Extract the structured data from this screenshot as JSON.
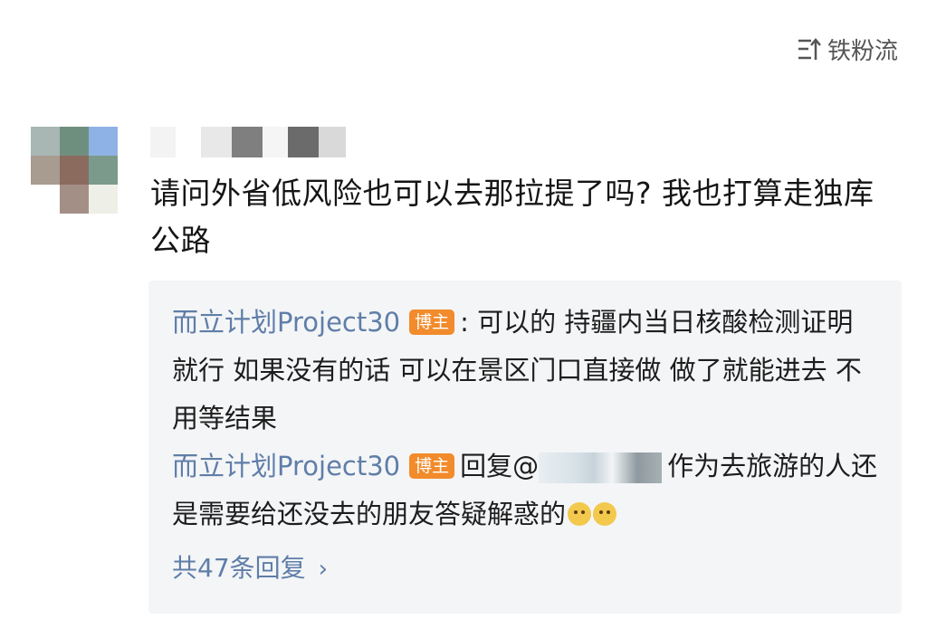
{
  "sort_button": {
    "label": "铁粉流",
    "icon": "sort-icon"
  },
  "comment": {
    "text": "请问外省低风险也可以去那拉提了吗? 我也打算走独库公路"
  },
  "replies": [
    {
      "author": "而立计划Project30",
      "badge": "博主",
      "text": ": 可以的 持疆内当日核酸检测证明就行 如果没有的话 可以在景区门口直接做 做了就能进去 不用等结果"
    },
    {
      "author": "而立计划Project30",
      "badge": "博主",
      "reply_prefix": "回复@",
      "text": "作为去旅游的人还是需要给还没去的朋友答疑解惑的"
    }
  ],
  "more_replies": {
    "label": "共47条回复",
    "chevron": "›"
  },
  "colors": {
    "author": "#5f7ea8",
    "badge": "#f28b2b",
    "reply_bg": "#f4f5f7"
  }
}
